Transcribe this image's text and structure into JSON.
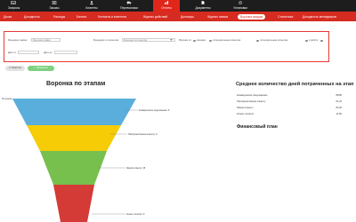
{
  "topnav": [
    {
      "label": "Запросы",
      "icon": "inbox-icon"
    },
    {
      "label": "Заказы",
      "icon": "orders-icon"
    },
    {
      "label": "Клиенты",
      "icon": "clients-icon"
    },
    {
      "label": "Перевозчики",
      "icon": "truck-icon"
    },
    {
      "label": "Отчеты",
      "icon": "chart-icon",
      "active": true
    },
    {
      "label": "Документы",
      "icon": "document-icon"
    },
    {
      "label": "Установки",
      "icon": "gear-icon"
    }
  ],
  "subnav": [
    {
      "label": "Доска"
    },
    {
      "label": "Доходность"
    },
    {
      "label": "Расходы"
    },
    {
      "label": "Баланс"
    },
    {
      "label": "Контакты и клиентов"
    },
    {
      "label": "Журнал действий"
    },
    {
      "label": "Договоры"
    },
    {
      "label": "Журнал заявок"
    },
    {
      "label": "Воронка продаж",
      "active": true
    },
    {
      "label": "Статистика"
    },
    {
      "label": "Доходность менеджеров"
    }
  ],
  "filters": {
    "manager_label": "Менеджер заявки",
    "manager_value": "Менеджер заявки",
    "client_manager_label": "Менеджер по клиентам",
    "client_manager_value": "Менеджер по клиентам",
    "funnel_label": "Воронка по:",
    "options": [
      "звонкам",
      "потенциальным клиентам",
      "потенциальным клиентам",
      "в работе"
    ],
    "date_from_label": "Дата от",
    "date_to_label": "Дата до",
    "reset_label": "Очистить",
    "apply_label": "Применить"
  },
  "funnel": {
    "title": "Воронка по этапам",
    "top_label": "Не в ветке",
    "stages": [
      {
        "label": "Коммерческое предложение: 9",
        "color": "#5aaedc"
      },
      {
        "label": "Повторный звонок клиенту: 9",
        "color": "#f5cc06"
      },
      {
        "label": "Звонок клиенту: 18",
        "color": "#77c04d"
      },
      {
        "label": "Клиент оплатил: 9",
        "color": "#d43a36"
      }
    ]
  },
  "days_table": {
    "title": "Среднее количество дней потраченных на этап",
    "rows": [
      {
        "name": "Коммерческое предложение",
        "value": "88.85"
      },
      {
        "name": "Повторный звонок клиенту",
        "value": "61.22"
      },
      {
        "name": "Звонок клиенту",
        "value": "84.26"
      },
      {
        "name": "Клиент оплатил",
        "value": "11.50"
      }
    ]
  },
  "finance": {
    "title": "Финансовый план"
  }
}
